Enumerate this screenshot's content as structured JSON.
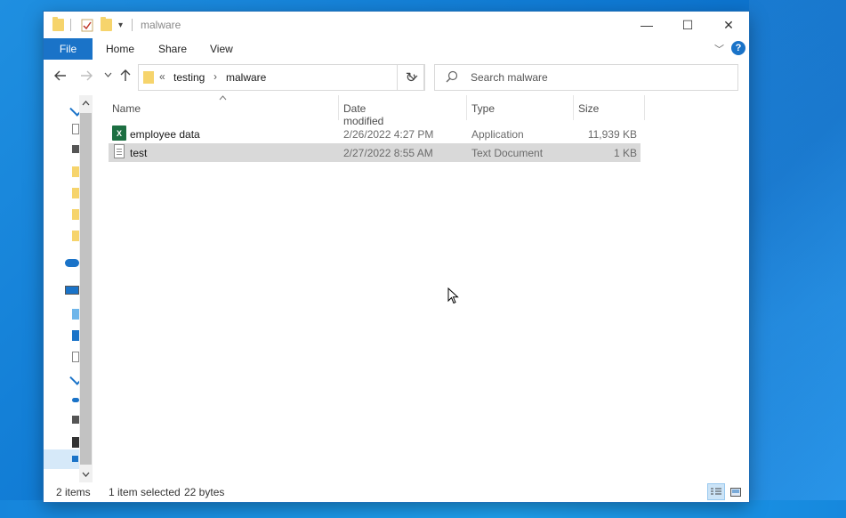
{
  "window": {
    "title": "malware",
    "minimize": "—",
    "maximize": "☐",
    "close": "✕"
  },
  "ribbon": {
    "tabs": [
      "File",
      "Home",
      "Share",
      "View"
    ],
    "help": "?"
  },
  "navigation": {
    "breadcrumb_prefix": "«",
    "breadcrumbs": [
      "testing",
      "malware"
    ],
    "search_placeholder": "Search malware"
  },
  "columns": [
    "Name",
    "Date modified",
    "Type",
    "Size"
  ],
  "files": [
    {
      "name": "employee data",
      "date": "2/26/2022 4:27 PM",
      "type": "Application",
      "size": "11,939 KB",
      "icon": "excel-icon",
      "selected": false
    },
    {
      "name": "test",
      "date": "2/27/2022 8:55 AM",
      "type": "Text Document",
      "size": "1 KB",
      "icon": "text-document-icon",
      "selected": true
    }
  ],
  "status": {
    "item_count": "2 items",
    "selection": "1 item selected",
    "selection_size": "22 bytes"
  },
  "colors": {
    "accent": "#1a73c8",
    "selected_row": "#d9d9d9",
    "folder": "#f6d46c",
    "excel": "#1d6f42"
  }
}
